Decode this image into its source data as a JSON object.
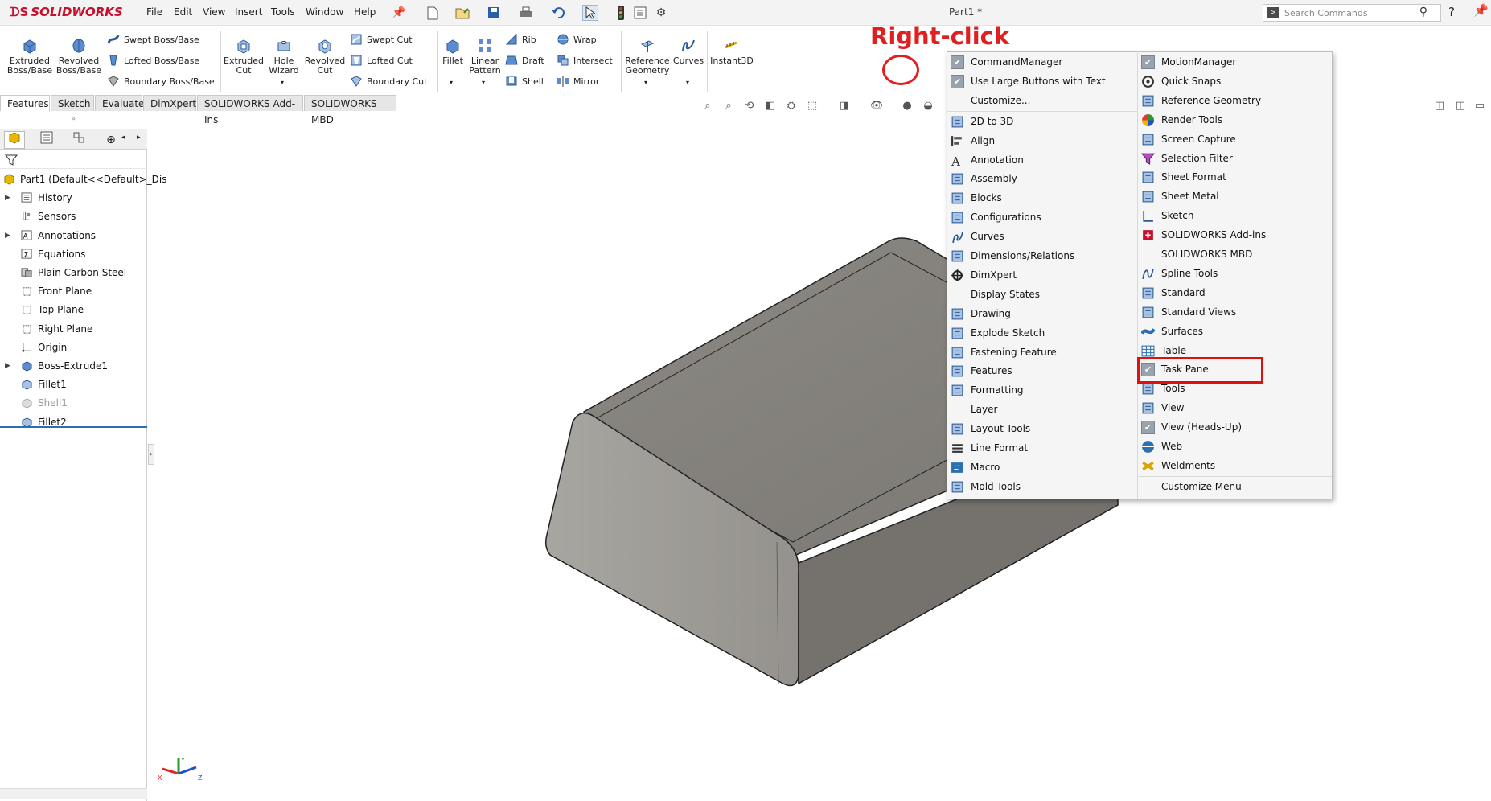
{
  "app": {
    "brand": "SOLIDWORKS",
    "document_title": "Part1 *"
  },
  "menubar": [
    "File",
    "Edit",
    "View",
    "Insert",
    "Tools",
    "Window",
    "Help"
  ],
  "search": {
    "placeholder": "Search Commands"
  },
  "help_symbol": "?",
  "command_manager": {
    "big_buttons": [
      {
        "label": "Extruded Boss/Base"
      },
      {
        "label": "Revolved Boss/Base"
      },
      {
        "label": "Extruded Cut"
      },
      {
        "label": "Hole Wizard"
      },
      {
        "label": "Revolved Cut"
      },
      {
        "label": "Fillet"
      },
      {
        "label": "Linear Pattern"
      },
      {
        "label": "Reference Geometry"
      },
      {
        "label": "Curves"
      },
      {
        "label": "Instant3D"
      }
    ],
    "small_buttons": {
      "col1": [
        "Swept Boss/Base",
        "Lofted Boss/Base",
        "Boundary Boss/Base"
      ],
      "col2": [
        "Swept Cut",
        "Lofted Cut",
        "Boundary Cut"
      ],
      "col3": [
        "Rib",
        "Draft",
        "Shell"
      ],
      "col4": [
        "Wrap",
        "Intersect",
        "Mirror"
      ]
    }
  },
  "tabs": [
    "Features",
    "Sketch",
    "Evaluate",
    "DimXpert",
    "SOLIDWORKS Add-Ins",
    "SOLIDWORKS MBD"
  ],
  "feature_tree": [
    {
      "label": "Part1  (Default<<Default>_Dis",
      "expand": false
    },
    {
      "label": "History",
      "expand": true
    },
    {
      "label": "Sensors",
      "expand": false
    },
    {
      "label": "Annotations",
      "expand": true
    },
    {
      "label": "Equations",
      "expand": false
    },
    {
      "label": "Plain Carbon Steel",
      "expand": false
    },
    {
      "label": "Front Plane",
      "expand": false
    },
    {
      "label": "Top Plane",
      "expand": false
    },
    {
      "label": "Right Plane",
      "expand": false
    },
    {
      "label": "Origin",
      "expand": false
    },
    {
      "label": "Boss-Extrude1",
      "expand": true
    },
    {
      "label": "Fillet1",
      "expand": false
    },
    {
      "label": "Shell1",
      "expand": false,
      "suppressed": true
    },
    {
      "label": "Fillet2",
      "expand": false
    }
  ],
  "annotation": {
    "text": "Right-click",
    "color": "#e02020"
  },
  "context_menu": {
    "left": [
      {
        "label": "CommandManager",
        "checked": true
      },
      {
        "label": "Use Large Buttons with Text",
        "checked": true
      },
      {
        "label": "Customize...",
        "checked": false
      },
      {
        "label": "2D to 3D",
        "icon": "2d-to-3d-icon"
      },
      {
        "label": "Align",
        "icon": "align-icon"
      },
      {
        "label": "Annotation",
        "icon": "annotation-icon"
      },
      {
        "label": "Assembly",
        "icon": "assembly-icon"
      },
      {
        "label": "Blocks",
        "icon": "blocks-icon"
      },
      {
        "label": "Configurations",
        "icon": "configurations-icon"
      },
      {
        "label": "Curves",
        "icon": "curves-icon"
      },
      {
        "label": "Dimensions/Relations",
        "icon": "dimensions-icon"
      },
      {
        "label": "DimXpert",
        "icon": "dimxpert-icon"
      },
      {
        "label": "Display States",
        "icon": ""
      },
      {
        "label": "Drawing",
        "icon": "drawing-icon"
      },
      {
        "label": "Explode Sketch",
        "icon": "explode-sketch-icon"
      },
      {
        "label": "Fastening Feature",
        "icon": "fastening-icon"
      },
      {
        "label": "Features",
        "icon": "features-icon"
      },
      {
        "label": "Formatting",
        "icon": "formatting-icon"
      },
      {
        "label": "Layer",
        "icon": ""
      },
      {
        "label": "Layout Tools",
        "icon": "layout-tools-icon"
      },
      {
        "label": "Line Format",
        "icon": "line-format-icon"
      },
      {
        "label": "Macro",
        "icon": "macro-icon"
      },
      {
        "label": "Mold Tools",
        "icon": "mold-tools-icon"
      }
    ],
    "right": [
      {
        "label": "MotionManager",
        "checked": true
      },
      {
        "label": "Quick Snaps",
        "icon": "quick-snaps-icon"
      },
      {
        "label": "Reference Geometry",
        "icon": "reference-geometry-icon"
      },
      {
        "label": "Render Tools",
        "icon": "render-tools-icon"
      },
      {
        "label": "Screen Capture",
        "icon": "screen-capture-icon"
      },
      {
        "label": "Selection Filter",
        "icon": "selection-filter-icon"
      },
      {
        "label": "Sheet Format",
        "icon": "sheet-format-icon"
      },
      {
        "label": "Sheet Metal",
        "icon": "sheet-metal-icon"
      },
      {
        "label": "Sketch",
        "icon": "sketch-icon"
      },
      {
        "label": "SOLIDWORKS Add-ins",
        "icon": "addins-icon"
      },
      {
        "label": "SOLIDWORKS MBD",
        "icon": ""
      },
      {
        "label": "Spline Tools",
        "icon": "spline-tools-icon"
      },
      {
        "label": "Standard",
        "icon": "standard-icon"
      },
      {
        "label": "Standard Views",
        "icon": "standard-views-icon"
      },
      {
        "label": "Surfaces",
        "icon": "surfaces-icon"
      },
      {
        "label": "Table",
        "icon": "table-icon"
      },
      {
        "label": "Task Pane",
        "checked": true
      },
      {
        "label": "Tools",
        "icon": "tools-icon"
      },
      {
        "label": "View",
        "icon": "view-icon"
      },
      {
        "label": "View (Heads-Up)",
        "checked": true
      },
      {
        "label": "Web",
        "icon": "web-icon"
      },
      {
        "label": "Weldments",
        "icon": "weldments-icon"
      },
      {
        "label": "Customize Menu",
        "icon": ""
      }
    ],
    "highlighted": "Task Pane",
    "highlight_color": "#e01010"
  },
  "triad_labels": {
    "x": "X",
    "y": "Y",
    "z": "Z"
  }
}
